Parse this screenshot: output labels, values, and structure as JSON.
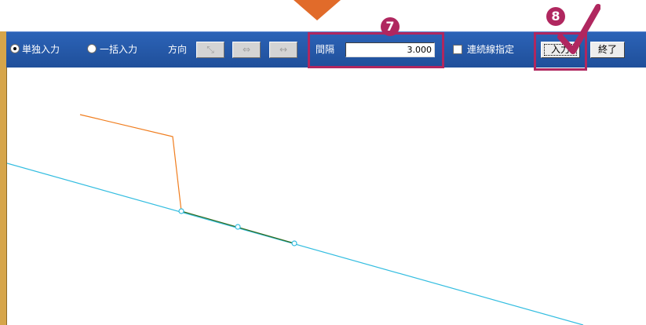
{
  "mode": {
    "single_label": "単独入力",
    "batch_label": "一括入力",
    "selected": "single"
  },
  "direction": {
    "label": "方向",
    "buttons": [
      "⤡",
      "⇔",
      "↔"
    ]
  },
  "interval": {
    "label": "間隔",
    "value": "3.000"
  },
  "continuous": {
    "label": "連続線指定",
    "checked": false
  },
  "buttons": {
    "input_label": "入力",
    "end_label": "終了"
  },
  "callouts": {
    "step7": "7",
    "step8": "8"
  },
  "colors": {
    "toolbar": "#1f4f9a",
    "accent": "#b0275f",
    "arrow": "#e16b2a",
    "line_orange": "#f07d1e",
    "line_cyan": "#33bde0",
    "line_green": "#2e6b1f"
  }
}
